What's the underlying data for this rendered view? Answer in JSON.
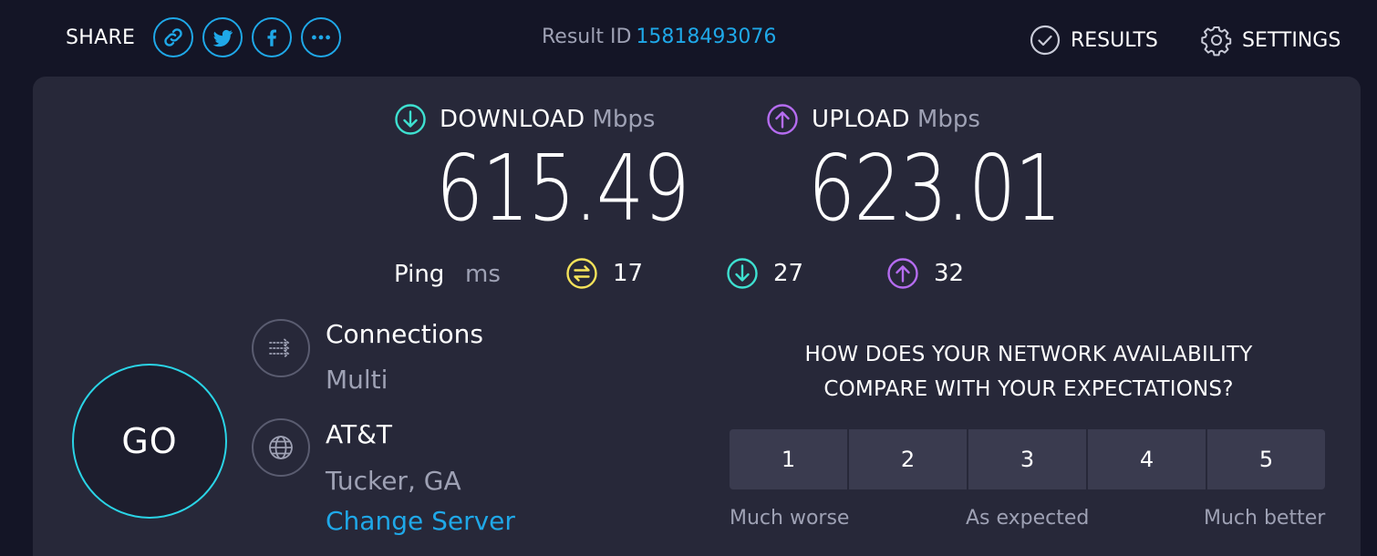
{
  "header": {
    "share_label": "SHARE",
    "share_buttons": [
      {
        "icon": "link-icon"
      },
      {
        "icon": "twitter-icon"
      },
      {
        "icon": "facebook-icon"
      },
      {
        "icon": "more-icon"
      }
    ],
    "result_id_label": "Result ID",
    "result_id_value": "15818493076",
    "results_label": "RESULTS",
    "settings_label": "SETTINGS"
  },
  "download": {
    "title": "DOWNLOAD",
    "unit": "Mbps",
    "value": "615.49",
    "color": "#3ee0d0"
  },
  "upload": {
    "title": "UPLOAD",
    "unit": "Mbps",
    "value": "623.01",
    "color": "#b56cf0"
  },
  "ping": {
    "label": "Ping",
    "unit": "ms",
    "idle": "17",
    "download": "27",
    "upload": "32",
    "idle_color": "#f5e35a"
  },
  "go_label": "GO",
  "connections": {
    "title": "Connections",
    "value": "Multi"
  },
  "isp": {
    "name": "AT&T",
    "location": "Tucker, GA",
    "change_server_label": "Change Server"
  },
  "survey": {
    "question_line1": "HOW DOES YOUR NETWORK AVAILABILITY",
    "question_line2": "COMPARE WITH YOUR EXPECTATIONS?",
    "ratings": [
      "1",
      "2",
      "3",
      "4",
      "5"
    ],
    "scale_low": "Much worse",
    "scale_mid": "As expected",
    "scale_high": "Much better"
  },
  "colors": {
    "accent": "#1fa8e8",
    "go_ring": "#2ad4e6",
    "card": "#272839",
    "background": "#141526"
  }
}
